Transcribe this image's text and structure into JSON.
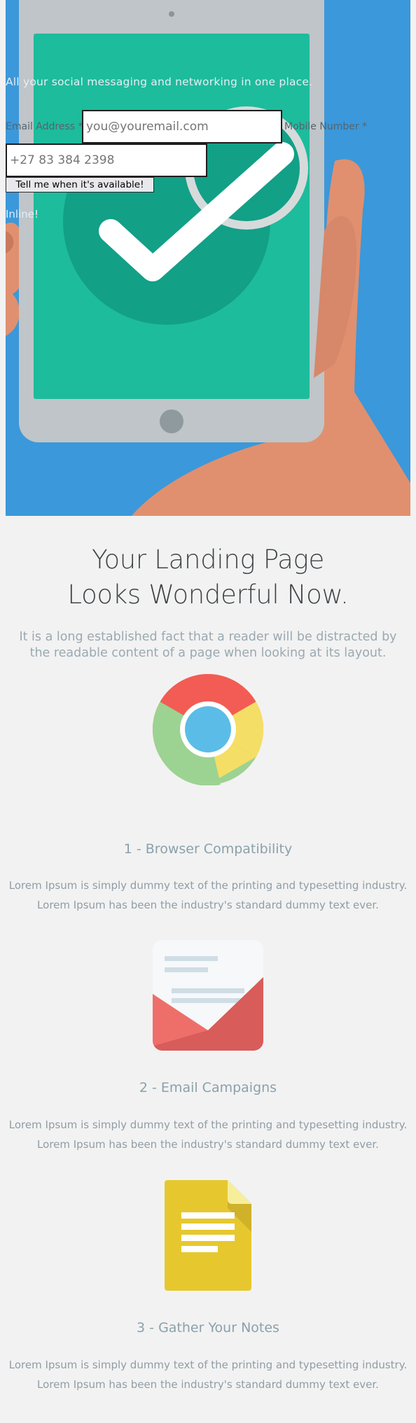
{
  "hero": {
    "tagline": "All your social messaging and networking in one place.",
    "form": {
      "email_label": "Email Address *",
      "email_placeholder": "you@youremail.com",
      "mobile_label": "Mobile Number *",
      "mobile_placeholder": "+27 83 384 2398",
      "submit_label": "Tell me when it's available!"
    },
    "inline_note": "Inline!",
    "illustration": "tablet-checkmark-hand"
  },
  "intro": {
    "headline_line1": "Your Landing Page",
    "headline_line2": "Looks Wonderful Now.",
    "lead": "It is a long established fact that a reader will be distracted by the readable content of a page when looking at its layout."
  },
  "features": [
    {
      "icon": "chrome-icon",
      "title": "1 - Browser Compatibility",
      "text": "Lorem Ipsum is simply dummy text of the printing and typesetting industry. Lorem Ipsum has been the industry's standard dummy text ever."
    },
    {
      "icon": "envelope-icon",
      "title": "2 - Email Campaigns",
      "text": "Lorem Ipsum is simply dummy text of the printing and typesetting industry. Lorem Ipsum has been the industry's standard dummy text ever."
    },
    {
      "icon": "notes-icon",
      "title": "3 - Gather Your Notes",
      "text": "Lorem Ipsum is simply dummy text of the printing and typesetting industry. Lorem Ipsum has been the industry's standard dummy text ever."
    }
  ],
  "colors": {
    "hero_bg": "#3b98da",
    "tablet_screen": "#1dbc9c",
    "page_bg": "#f2f2f2",
    "heading": "#3f4346",
    "muted_text": "#9aa9b2"
  }
}
